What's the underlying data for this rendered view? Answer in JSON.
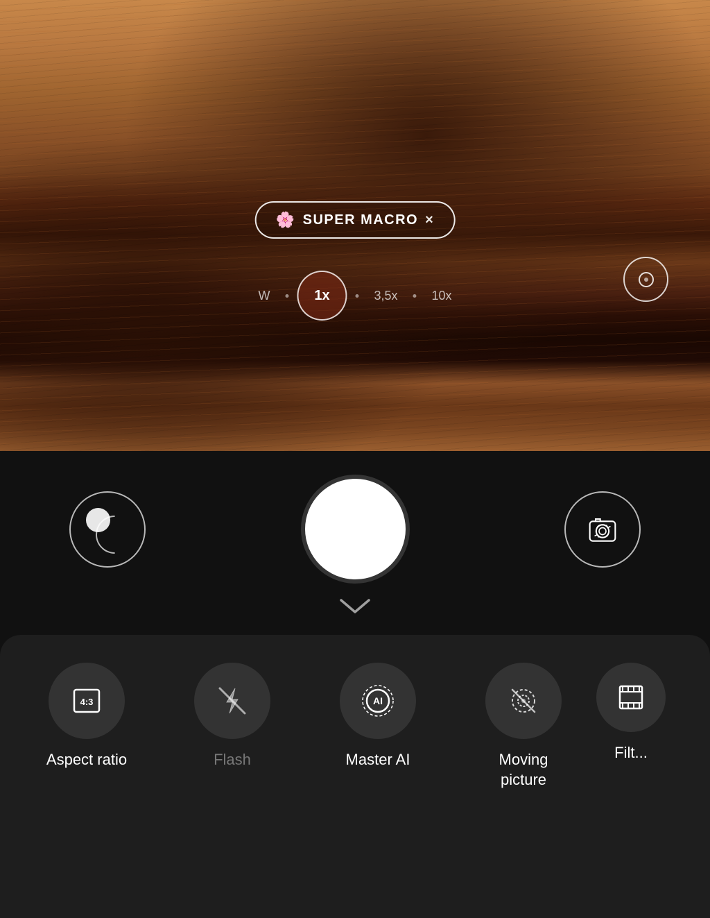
{
  "viewfinder": {
    "mode_badge": {
      "icon": "🌸",
      "label": "SUPER MACRO",
      "close": "×"
    },
    "zoom": {
      "options": [
        "W",
        "1x",
        "3,5x",
        "10x"
      ],
      "active_index": 1
    }
  },
  "controls": {
    "chevron_label": "⌄",
    "shutter_label": "",
    "gallery_label": "",
    "flip_label": ""
  },
  "quick_settings": [
    {
      "id": "aspect-ratio",
      "label": "Aspect ratio",
      "icon_type": "aspect-ratio",
      "dimmed": false
    },
    {
      "id": "flash",
      "label": "Flash",
      "icon_type": "flash-off",
      "dimmed": true
    },
    {
      "id": "master-ai",
      "label": "Master AI",
      "icon_type": "ai",
      "dimmed": false
    },
    {
      "id": "moving-picture",
      "label": "Moving\npicture",
      "icon_type": "moving-picture",
      "dimmed": false
    },
    {
      "id": "filter",
      "label": "Filt...",
      "icon_type": "filter",
      "dimmed": false
    }
  ]
}
